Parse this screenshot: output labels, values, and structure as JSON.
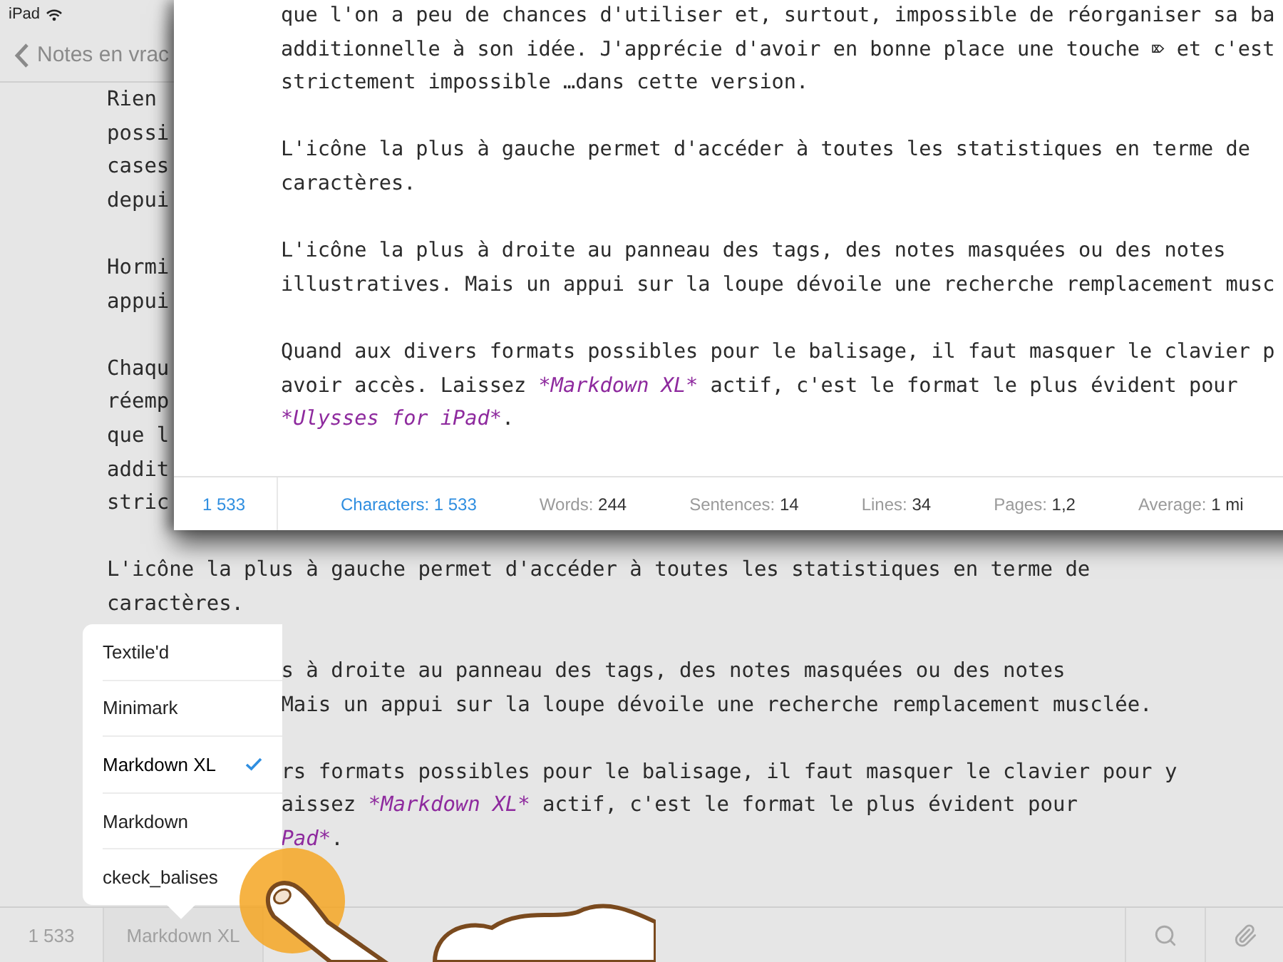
{
  "status_bar": {
    "device": "iPad"
  },
  "nav": {
    "back_label": "Notes en vrac"
  },
  "editor": {
    "paragraphs": [
      {
        "lines": [
          {
            "text": "Rien"
          },
          {
            "text": "possi"
          },
          {
            "text": "cases"
          },
          {
            "text": "depui"
          }
        ]
      },
      {
        "lines": [
          {
            "text": "Hormi"
          },
          {
            "text": "appui"
          }
        ]
      },
      {
        "lines": [
          {
            "text": "Chaqu"
          },
          {
            "text": "réemp"
          },
          {
            "text": "que l"
          },
          {
            "text": "addit"
          },
          {
            "text": "stric"
          }
        ]
      },
      {
        "lines": [
          {
            "text": "L'icône la plus à gauche permet d'accéder à toutes les statistiques en terme de"
          },
          {
            "text": "caractères."
          }
        ]
      },
      {
        "lines": [
          {
            "text": "s à droite au panneau des tags, des notes masquées ou des notes",
            "kind": "beside-menu"
          },
          {
            "text": "Mais un appui sur la loupe dévoile une recherche remplacement musclée.",
            "kind": "beside-menu"
          }
        ]
      },
      {
        "lines": [
          {
            "text": "rs formats possibles pour le balisage, il faut masquer le clavier pour y",
            "kind": "beside-menu"
          },
          {
            "kind": "beside-menu",
            "segments": [
              {
                "kind": "plain",
                "text": "aissez "
              },
              {
                "kind": "markup",
                "text": "*Markdown XL*"
              },
              {
                "kind": "plain",
                "text": " actif, c'est le format le plus évident pour"
              }
            ]
          },
          {
            "kind": "beside-menu",
            "segments": [
              {
                "kind": "markup",
                "text": "Pad*"
              },
              {
                "kind": "plain",
                "text": "."
              }
            ]
          }
        ]
      }
    ]
  },
  "format_menu": {
    "items": [
      {
        "label": "Textile'd",
        "selected": false
      },
      {
        "label": "Minimark",
        "selected": false
      },
      {
        "label": "Markdown XL",
        "selected": true
      },
      {
        "label": "Markdown",
        "selected": false
      },
      {
        "label": "ckeck_balises",
        "selected": false
      }
    ]
  },
  "toolbar": {
    "count": "1 533",
    "format": "Markdown XL"
  },
  "stats_panel": {
    "paragraphs": [
      {
        "lines": [
          {
            "text": "que l'on a peu de chances d'utiliser et, surtout, impossible de réorganiser sa ba"
          },
          {
            "text": "additionnelle à son idée. J'apprécie d'avoir en bonne place une touche ⌦ et c'est"
          },
          {
            "text": "strictement impossible …dans cette version."
          }
        ]
      },
      {
        "lines": [
          {
            "text": "L'icône la plus à gauche permet d'accéder à toutes les statistiques en terme de"
          },
          {
            "text": "caractères."
          }
        ]
      },
      {
        "lines": [
          {
            "text": "L'icône la plus à droite au panneau des tags, des notes masquées ou des notes"
          },
          {
            "text": "illustratives. Mais un appui sur la loupe dévoile une recherche remplacement musc"
          }
        ]
      },
      {
        "lines": [
          {
            "text": "Quand aux divers formats possibles pour le balisage, il faut masquer le clavier p"
          },
          {
            "segments": [
              {
                "kind": "plain",
                "text": "avoir accès. Laissez "
              },
              {
                "kind": "markup",
                "text": "*Markdown XL*"
              },
              {
                "kind": "plain",
                "text": " actif, c'est le format le plus évident pour"
              }
            ]
          },
          {
            "segments": [
              {
                "kind": "markup",
                "text": "*Ulysses for iPad*"
              },
              {
                "kind": "plain",
                "text": "."
              }
            ]
          }
        ]
      }
    ],
    "total": "1 533",
    "stats": [
      {
        "label": "Characters:",
        "value": "1 533",
        "active": true
      },
      {
        "label": "Words:",
        "value": "244",
        "active": false
      },
      {
        "label": "Sentences:",
        "value": "14",
        "active": false
      },
      {
        "label": "Lines:",
        "value": "34",
        "active": false
      },
      {
        "label": "Pages:",
        "value": "1,2",
        "active": false
      },
      {
        "label": "Average:",
        "value": "1 mi",
        "active": false
      }
    ]
  }
}
